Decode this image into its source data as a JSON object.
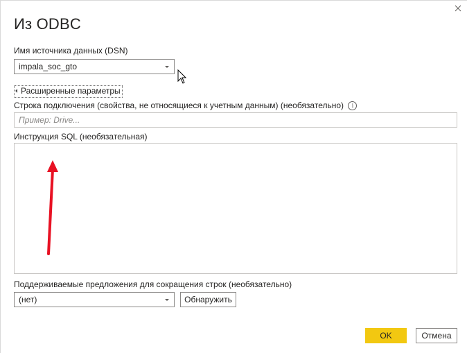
{
  "dialog": {
    "title": "Из ODBC",
    "close_icon": "close-icon"
  },
  "dsn": {
    "label": "Имя источника данных (DSN)",
    "value": "impala_soc_gto"
  },
  "advanced": {
    "toggle_label": "Расширенные параметры"
  },
  "connection_string": {
    "label": "Строка подключения (свойства, не относящиеся к учетным данным) (необязательно)",
    "info_icon": "i",
    "placeholder": "Пример: Drive...",
    "value": ""
  },
  "sql": {
    "label": "Инструкция SQL (необязательная)",
    "value": ""
  },
  "row_reduction": {
    "label": "Поддерживаемые предложения для сокращения строк (необязательно)",
    "value": "(нет)",
    "detect_button": "Обнаружить"
  },
  "footer": {
    "ok_button": "OK",
    "cancel_button": "Отмена"
  },
  "colors": {
    "primary": "#f2c811",
    "annotation_arrow": "#e81123",
    "border": "#8a8886"
  }
}
